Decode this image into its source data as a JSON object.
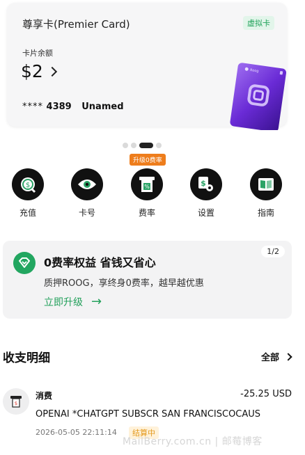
{
  "card": {
    "title": "尊享卡(Premier Card)",
    "badge": "虚拟卡",
    "balance_label": "卡片余额",
    "balance": "$2",
    "masked_number": "****",
    "last4": "4389",
    "holder": "Unamed",
    "card_brand_text": "Roog"
  },
  "pager": {
    "count": 4,
    "active_index": 2
  },
  "actions": {
    "promo_tag": "升级0费率",
    "items": [
      {
        "label": "充值",
        "icon": "recharge-icon"
      },
      {
        "label": "卡号",
        "icon": "eye-icon"
      },
      {
        "label": "费率",
        "icon": "fee-rate-icon"
      },
      {
        "label": "设置",
        "icon": "settings-icon"
      },
      {
        "label": "指南",
        "icon": "guide-book-icon"
      }
    ]
  },
  "promo": {
    "title": "0费率权益 省钱又省心",
    "page": "1/2",
    "desc": "质押ROOG，享终身0费率，越早越优惠",
    "link": "立即升级"
  },
  "transactions": {
    "header": "收支明细",
    "all_label": "全部",
    "items": [
      {
        "type": "消费",
        "amount": "-25.25 USD",
        "merchant": "OPENAI *CHATGPT SUBSCR SAN FRANCISCOCAUS",
        "time": "2026-05-05 22:11:14",
        "status": "结算中"
      }
    ]
  },
  "watermark": "MailBerry.com.cn  |  邮莓博客",
  "colors": {
    "accent_green": "#23a05b",
    "promo_orange": "#ee7d1c",
    "status_orange": "#e49a1f",
    "card_purple": "#6a2bd6"
  }
}
